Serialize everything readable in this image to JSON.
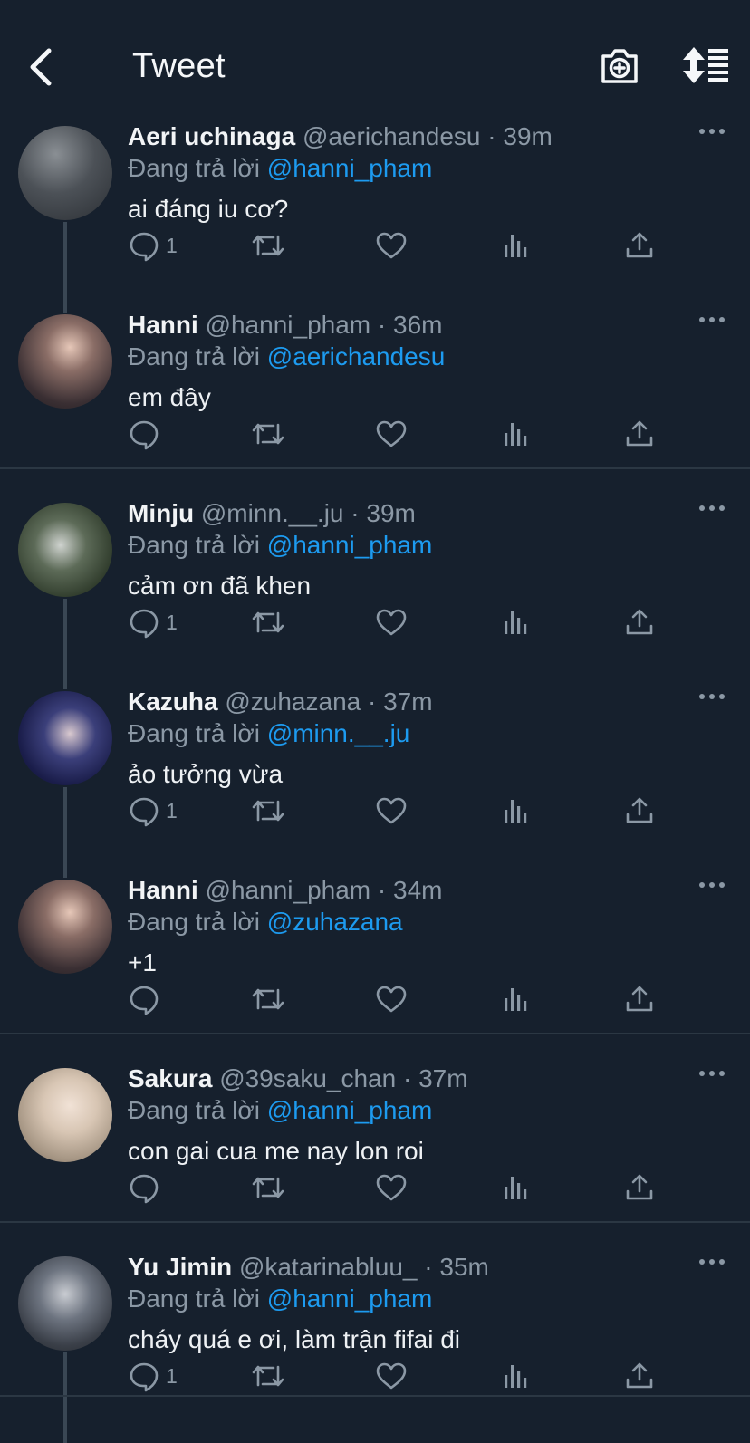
{
  "header": {
    "title": "Tweet",
    "back_icon": "chevron-left-icon",
    "camera_icon": "camera-plus-icon",
    "sort_icon": "sort-arrows-icon"
  },
  "colors": {
    "background": "#16202d",
    "link": "#1d9bf0",
    "muted": "#8b98a5",
    "divider": "#2b3743"
  },
  "tweets": [
    {
      "name": "Aeri uchinaga",
      "handle_time": "@aerichandesu · 39m",
      "reply_prefix": "Đang trả lời ",
      "reply_to": "@hanni_pham",
      "text": "ai đáng iu cơ?",
      "reply_count": "1"
    },
    {
      "name": "Hanni",
      "handle_time": "@hanni_pham · 36m",
      "reply_prefix": "Đang trả lời ",
      "reply_to": "@aerichandesu",
      "text": "em đây",
      "reply_count": ""
    },
    {
      "name": "Minju",
      "handle_time": "@minn.__.ju · 39m",
      "reply_prefix": "Đang trả lời ",
      "reply_to": "@hanni_pham",
      "text": "cảm ơn đã khen",
      "reply_count": "1"
    },
    {
      "name": "Kazuha",
      "handle_time": "@zuhazana · 37m",
      "reply_prefix": "Đang trả lời ",
      "reply_to": "@minn.__.ju",
      "text": "ảo tưởng vừa",
      "reply_count": "1"
    },
    {
      "name": "Hanni",
      "handle_time": "@hanni_pham · 34m",
      "reply_prefix": "Đang trả lời ",
      "reply_to": "@zuhazana",
      "text": "+1",
      "reply_count": ""
    },
    {
      "name": "Sakura",
      "handle_time": "@39saku_chan · 37m",
      "reply_prefix": "Đang trả lời ",
      "reply_to": "@hanni_pham",
      "text": "con gai cua me nay lon roi",
      "reply_count": ""
    },
    {
      "name": "Yu Jimin",
      "handle_time": "@katarinabluu_ · 35m",
      "reply_prefix": "Đang trả lời ",
      "reply_to": "@hanni_pham",
      "text": "cháy quá e ơi, làm trận fifai đi",
      "reply_count": "1"
    }
  ],
  "action_icons": [
    "reply-icon",
    "retweet-icon",
    "like-icon",
    "views-icon",
    "share-icon"
  ]
}
